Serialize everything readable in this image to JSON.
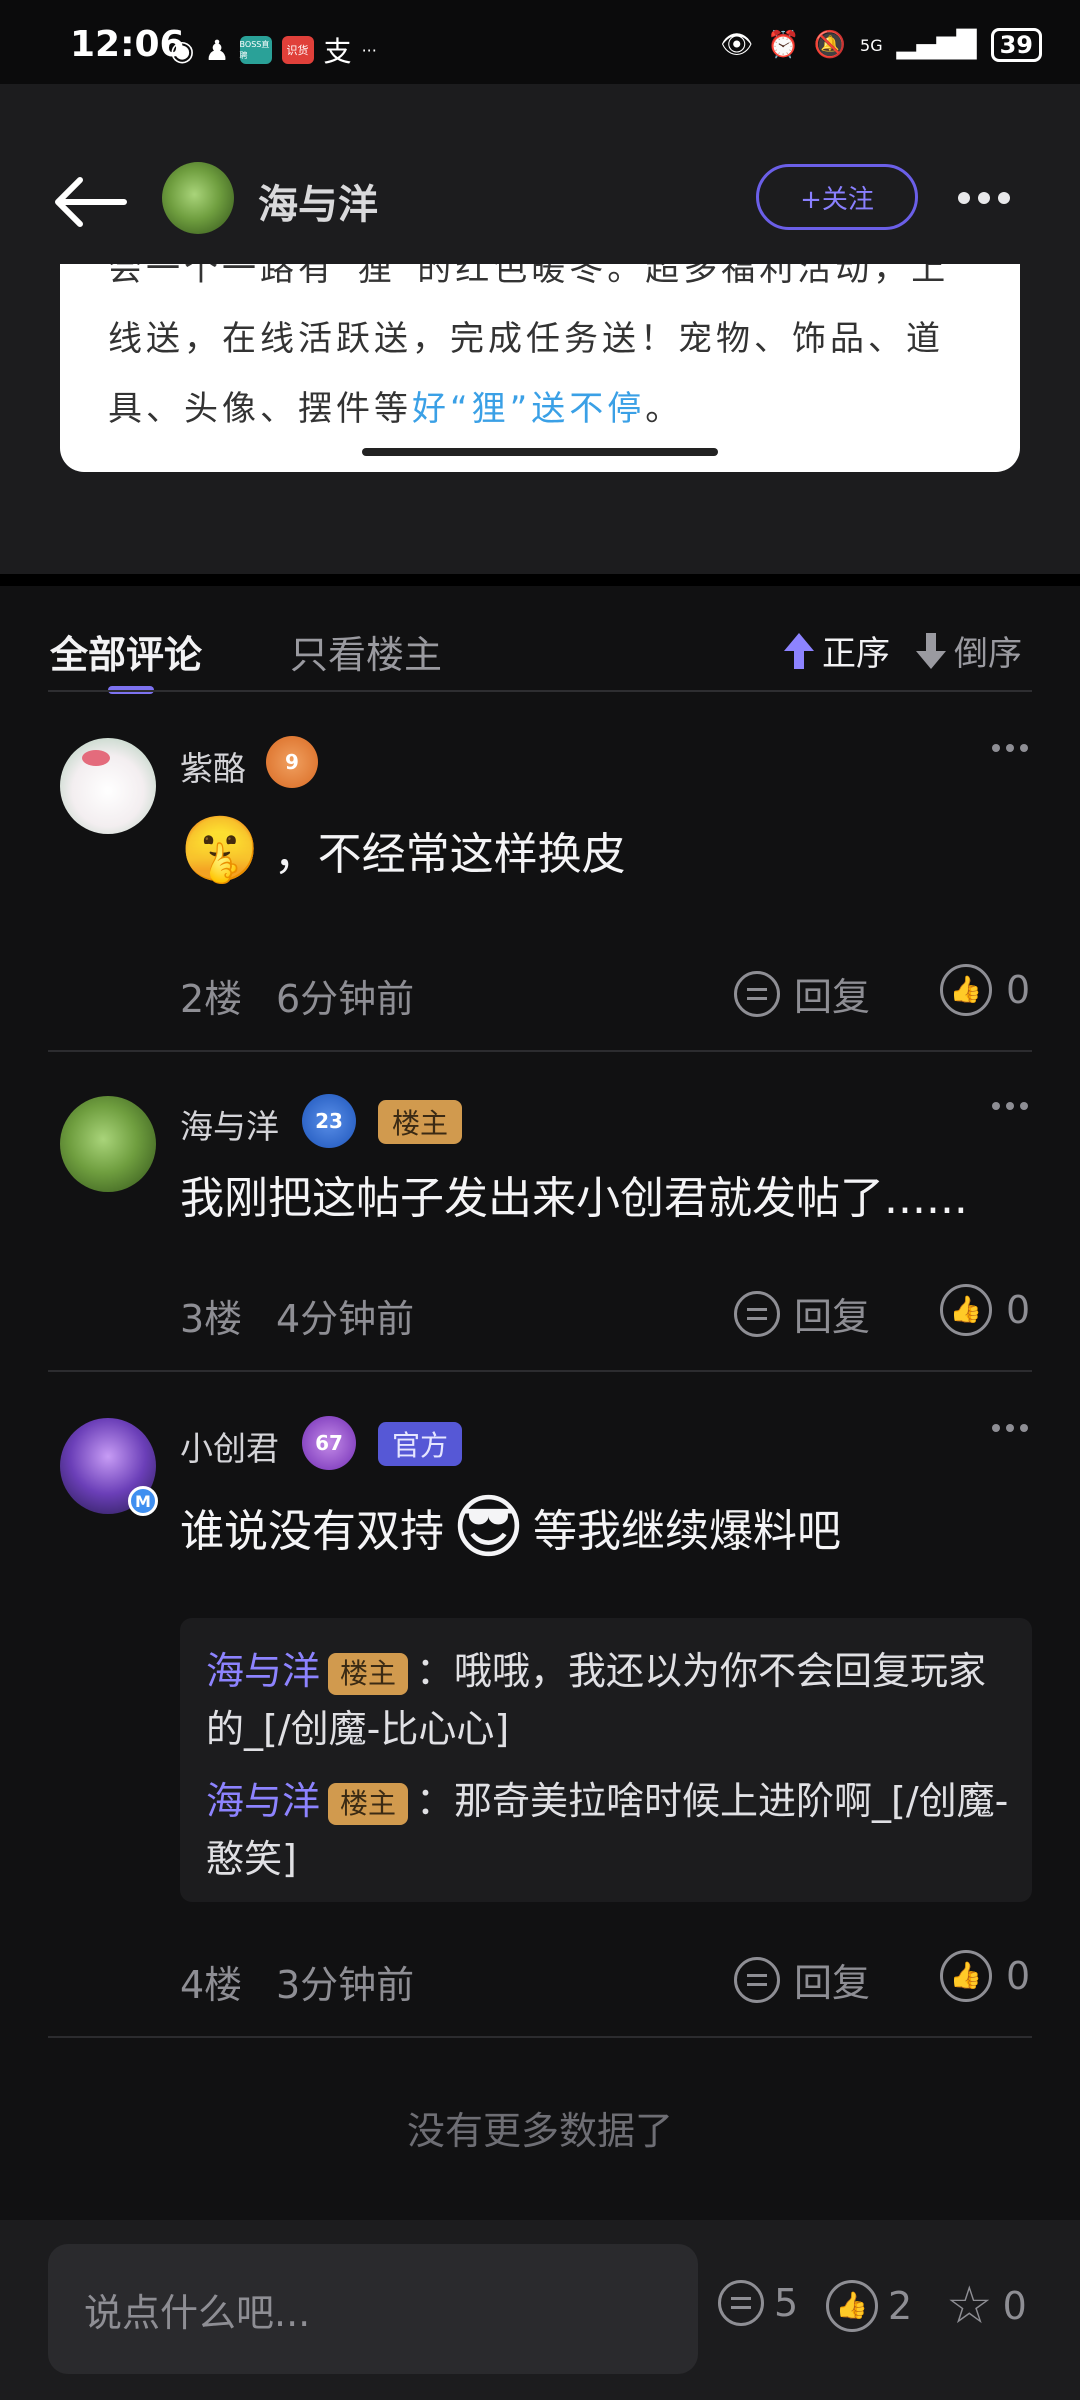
{
  "status_bar": {
    "time": "12:06",
    "notif_icons": [
      "wechat-icon",
      "qq-icon",
      "boss-zhipin-icon",
      "shipinhao-icon",
      "alipay-icon"
    ],
    "boss_label": "BOSS直聘",
    "red_label": "识货",
    "ellipsis": "···",
    "network": "5G",
    "battery": "39"
  },
  "header": {
    "author_name": "海与洋",
    "follow_label": "+关注"
  },
  "post": {
    "line1": "会一个一路有“狸”的红色暖冬。超多福利活动，上",
    "line2": "线送，在线活跃送，完成任务送！宠物、饰品、道",
    "line3_prefix": "具、头像、摆件等",
    "line3_highlight": "好“狸”送不停",
    "line3_suffix": "。"
  },
  "tabs": {
    "all": "全部评论",
    "owner_only": "只看楼主",
    "asc": "正序",
    "desc": "倒序"
  },
  "comments": [
    {
      "user": "紫酪",
      "level": "9",
      "text": "，不经常这样换皮",
      "emoji": "🤫",
      "floor": "2楼",
      "time": "6分钟前",
      "reply_label": "回复",
      "likes": "0"
    },
    {
      "user": "海与洋",
      "level": "23",
      "tag": "楼主",
      "text": "我刚把这帖子发出来小创君就发帖了......",
      "floor": "3楼",
      "time": "4分钟前",
      "reply_label": "回复",
      "likes": "0"
    },
    {
      "user": "小创君",
      "level": "67",
      "tag": "官方",
      "text_before": "谁说没有双持",
      "emoji": "😎",
      "text_after": "等我继续爆料吧",
      "floor": "4楼",
      "time": "3分钟前",
      "reply_label": "回复",
      "likes": "0",
      "replies": [
        {
          "name": "海与洋",
          "tag": "楼主",
          "text": "：哦哦，我还以为你不会回复玩家的_[/创魔-比心心]"
        },
        {
          "name": "海与洋",
          "tag": "楼主",
          "text": "：那奇美拉啥时候上进阶啊_[/创魔-憨笑]"
        }
      ]
    }
  ],
  "no_more": "没有更多数据了",
  "bottom_bar": {
    "placeholder": "说点什么吧...",
    "comments": "5",
    "likes": "2",
    "favorites": "0"
  }
}
